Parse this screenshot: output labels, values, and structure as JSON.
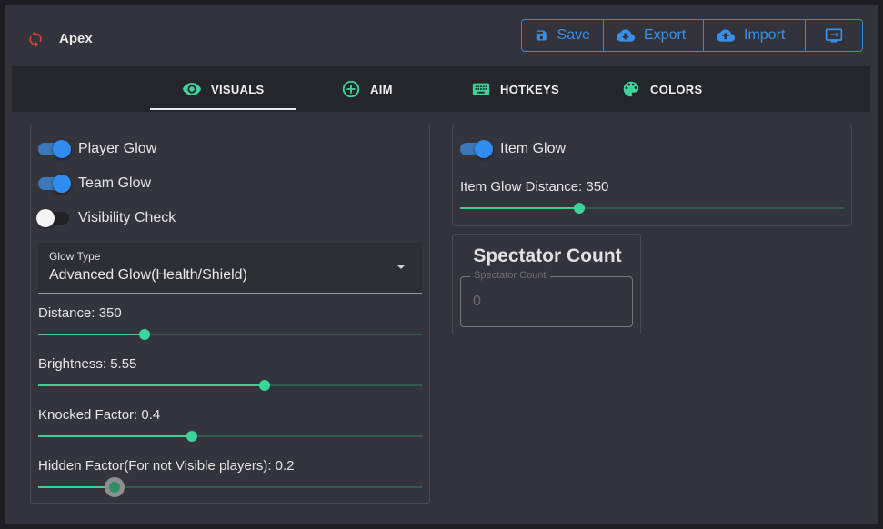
{
  "app": {
    "title": "Apex",
    "icon": "refresh-icon",
    "icon_color": "#e53935"
  },
  "toolbar": {
    "save_label": "Save",
    "export_label": "Export",
    "import_label": "Import",
    "accent": "#3a8fe8"
  },
  "tabs": [
    {
      "label": "VISUALS",
      "icon": "eye-icon",
      "active": true
    },
    {
      "label": "AIM",
      "icon": "plus-circle-icon",
      "active": false
    },
    {
      "label": "HOTKEYS",
      "icon": "keyboard-icon",
      "active": false
    },
    {
      "label": "COLORS",
      "icon": "palette-icon",
      "active": false
    }
  ],
  "visuals": {
    "player_glow": {
      "label": "Player Glow",
      "on": true
    },
    "team_glow": {
      "label": "Team Glow",
      "on": true
    },
    "visibility_check": {
      "label": "Visibility Check",
      "on": false
    },
    "glow_type": {
      "label": "Glow Type",
      "value": "Advanced Glow(Health/Shield)"
    },
    "distance": {
      "label": "Distance: 350",
      "fraction": 0.277
    },
    "brightness": {
      "label": "Brightness: 5.55",
      "fraction": 0.59
    },
    "knocked_factor": {
      "label": "Knocked Factor: 0.4",
      "fraction": 0.4
    },
    "hidden_factor": {
      "label": "Hidden Factor(For not Visible players): 0.2",
      "fraction": 0.2
    }
  },
  "items": {
    "item_glow": {
      "label": "Item Glow",
      "on": true
    },
    "item_glow_distance": {
      "label": "Item Glow Distance: 350",
      "fraction": 0.31
    }
  },
  "spectator": {
    "title": "Spectator Count",
    "field_label": "Spectator Count",
    "value": "0"
  },
  "colors": {
    "slider": "#3dd39a",
    "toggle_on": "#2f8cf0"
  }
}
